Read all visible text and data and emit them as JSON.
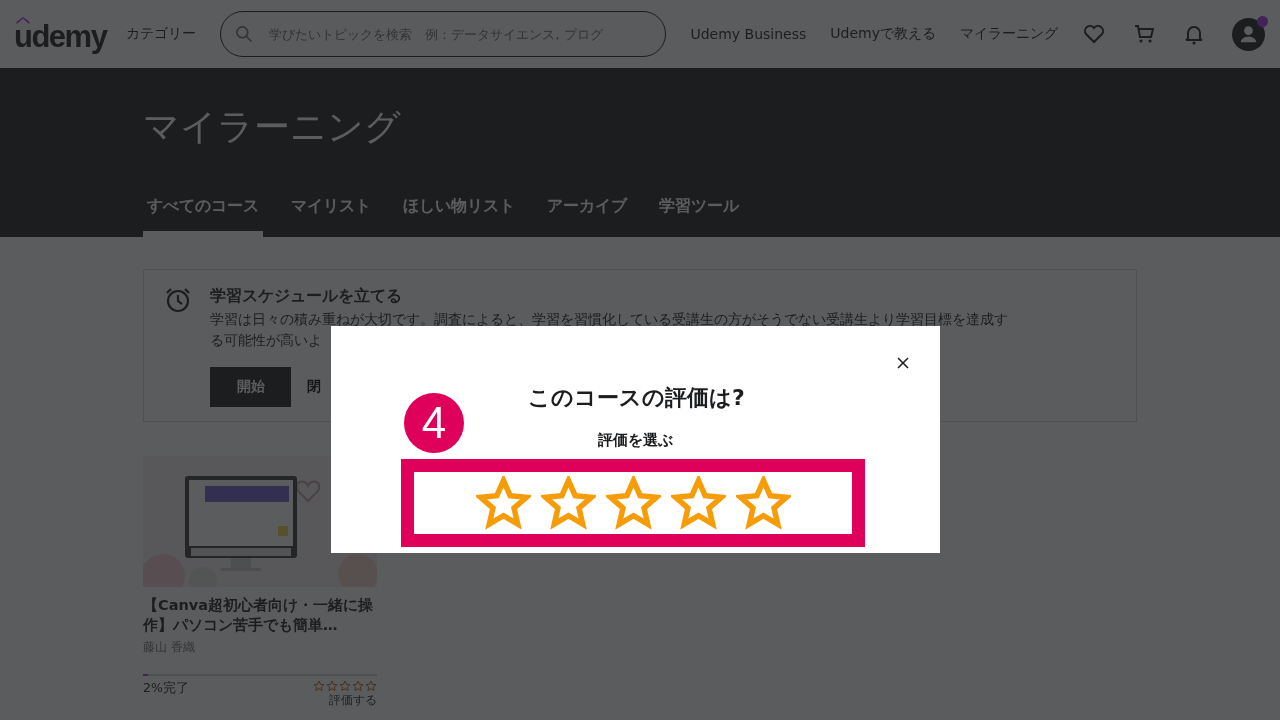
{
  "header": {
    "logo": "udemy",
    "categories": "カテゴリー",
    "search": {
      "placeholder": "学びたいトピックを検索　例：データサイエンス, プログ"
    },
    "links": [
      "Udemy Business",
      "Udemyで教える",
      "マイラーニング"
    ],
    "notification_dot": true
  },
  "hero": {
    "title": "マイラーニング",
    "tabs": [
      {
        "label": "すべてのコース",
        "selected": true
      },
      {
        "label": "マイリスト",
        "selected": false
      },
      {
        "label": "ほしい物リスト",
        "selected": false
      },
      {
        "label": "アーカイブ",
        "selected": false
      },
      {
        "label": "学習ツール",
        "selected": false
      }
    ]
  },
  "schedule": {
    "title": "学習スケジュールを立てる",
    "text_line_1": "学習は日々の積み重ねが大切です。調査によると、学習を習慣化している受講生の方がそうでない受講生より学習目標を達成す",
    "text_line_2": "る可能性が高いよ",
    "start_button": "開始",
    "close_button": "閉"
  },
  "course": {
    "title": "【Canva超初心者向け・一緒に操作】パソコン苦手でも簡単…",
    "instructor": "藤山 香織",
    "level": 0.02,
    "progress": "2%完了",
    "stars": 0,
    "rate_link": "評価する"
  },
  "modal": {
    "title": "このコースの評価は?",
    "subtitle": "評価を選ぶ",
    "stars": 0,
    "step_badge": "4"
  }
}
